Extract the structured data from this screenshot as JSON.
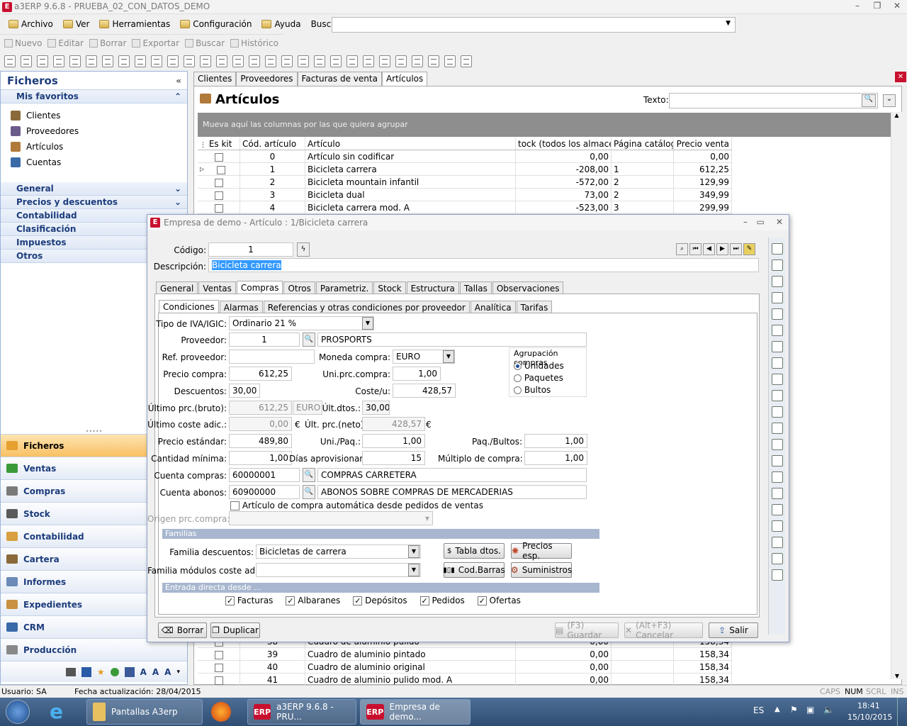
{
  "window": {
    "title": "a3ERP 9.6.8 - PRUEBA_02_CON_DATOS_DEMO",
    "logo": "E"
  },
  "menu": {
    "items": [
      "Archivo",
      "Ver",
      "Herramientas",
      "Configuración",
      "Ayuda"
    ],
    "search_label": "Buscar opción:",
    "search_value": ""
  },
  "toolbar": {
    "nuevo": "Nuevo",
    "editar": "Editar",
    "borrar": "Borrar",
    "exportar": "Exportar",
    "buscar": "Buscar",
    "historico": "Histórico"
  },
  "left": {
    "title": "Ficheros",
    "favorites_title": "Mis favoritos",
    "favorites": [
      "Clientes",
      "Proveedores",
      "Artículos",
      "Cuentas"
    ],
    "sections": [
      "General",
      "Precios y descuentos",
      "Contabilidad",
      "Clasificación",
      "Impuestos",
      "Otros"
    ],
    "nav": [
      "Ficheros",
      "Ventas",
      "Compras",
      "Stock",
      "Contabilidad",
      "Cartera",
      "Informes",
      "Expedientes",
      "CRM",
      "Producción"
    ],
    "bottom_icons": [
      "monitor-icon",
      "iva-free-icon",
      "star-icon",
      "globe-icon",
      "chart-icon",
      "a3-icon",
      "a3-icon",
      "a3-icon"
    ]
  },
  "tabs": [
    "Clientes",
    "Proveedores",
    "Facturas de venta",
    "Artículos"
  ],
  "articles": {
    "title": "Artículos",
    "text_label": "Texto:",
    "group_hint": "Mueva aquí las columnas por las que quiera agrupar",
    "columns": [
      "Es kit",
      "Cód. artículo",
      "Artículo",
      "tock (todos los almacenes)",
      "Página catálogo",
      "Precio venta"
    ],
    "rows": [
      {
        "cod": "0",
        "art": "Artículo sin codificar",
        "stock": "0,00",
        "pag": "",
        "precio": "0,00"
      },
      {
        "cod": "1",
        "art": "Bicicleta carrera",
        "stock": "-208,00",
        "pag": "1",
        "precio": "612,25"
      },
      {
        "cod": "2",
        "art": "Bicicleta mountain infantil",
        "stock": "-572,00",
        "pag": "2",
        "precio": "129,99"
      },
      {
        "cod": "3",
        "art": "Bicicleta dual",
        "stock": "73,00",
        "pag": "2",
        "precio": "349,99"
      },
      {
        "cod": "4",
        "art": "Bicicleta carrera mod. A",
        "stock": "-523,00",
        "pag": "3",
        "precio": "299,99"
      }
    ],
    "rows_bottom": [
      {
        "cod": "38",
        "art": "Cuadro de aluminio pulido",
        "stock": "0,00",
        "pag": "",
        "precio": "158,34"
      },
      {
        "cod": "39",
        "art": "Cuadro de aluminio pintado",
        "stock": "0,00",
        "pag": "",
        "precio": "158,34"
      },
      {
        "cod": "40",
        "art": "Cuadro de aluminio original",
        "stock": "0,00",
        "pag": "",
        "precio": "158,34"
      },
      {
        "cod": "41",
        "art": "Cuadro de aluminio pulido mod. A",
        "stock": "0,00",
        "pag": "",
        "precio": "158,34"
      }
    ]
  },
  "dialog": {
    "title": "Empresa de demo - Artículo : 1/Bicicleta carrera",
    "codigo_label": "Código:",
    "codigo": "1",
    "descripcion_label": "Descripción:",
    "descripcion": "Bicicleta carrera",
    "tabs": [
      "General",
      "Ventas",
      "Compras",
      "Otros",
      "Parametriz.",
      "Stock",
      "Estructura",
      "Tallas",
      "Observaciones"
    ],
    "subtabs": [
      "Condiciones",
      "Alarmas",
      "Referencias y otras condiciones por proveedor",
      "Analítica",
      "Tarifas"
    ],
    "tipo_iva_label": "Tipo de IVA/IGIC:",
    "tipo_iva": "Ordinario 21 %",
    "proveedor_label": "Proveedor:",
    "proveedor": "1",
    "proveedor_nombre": "PROSPORTS",
    "ref_prov_label": "Ref. proveedor:",
    "ref_prov": "",
    "moneda_label": "Moneda compra:",
    "moneda": "EURO",
    "precio_compra_label": "Precio compra:",
    "precio_compra": "612,25",
    "uni_prc_label": "Uni.prc.compra:",
    "uni_prc": "1,00",
    "descuentos_label": "Descuentos:",
    "descuentos": "30,00",
    "coste_label": "Coste/u:",
    "coste": "428,57",
    "ultimo_prc_label": "Último prc.(bruto):",
    "ultimo_prc": "612,25",
    "ultimo_moneda": "EURO",
    "ult_dtos_label": "Últ.dtos.:",
    "ult_dtos": "30,00",
    "ultimo_coste_label": "Último coste adic.:",
    "ultimo_coste": "0,00",
    "euro": "€",
    "ult_neto_label": "Últ. prc.(neto):",
    "ult_neto": "428,57",
    "precio_std_label": "Precio estándar:",
    "precio_std": "489,80",
    "uni_paq_label": "Uni./Paq.:",
    "uni_paq": "1,00",
    "paq_bultos_label": "Paq./Bultos:",
    "paq_bultos": "1,00",
    "cant_min_label": "Cantidad mínima:",
    "cant_min": "1,00",
    "dias_label": "Días aprovisionam.:",
    "dias": "15",
    "multiplo_label": "Múltiplo de compra:",
    "multiplo": "1,00",
    "cta_compras_label": "Cuenta compras:",
    "cta_compras": "60000001",
    "cta_compras_nombre": "COMPRAS CARRETERA",
    "cta_abonos_label": "Cuenta abonos:",
    "cta_abonos": "60900000",
    "cta_abonos_nombre": "ABONOS SOBRE COMPRAS DE MERCADERIAS",
    "auto_label": "Artículo de compra automática desde pedidos de ventas",
    "origen_label": "Origen prc.compra:",
    "agrup_title": "Agrupación compras",
    "agrup_options": [
      "Unidades",
      "Paquetes",
      "Bultos"
    ],
    "familias_band": "Familias",
    "fam_dtos_label": "Familia descuentos:",
    "fam_dtos": "Bicicletas de carrera",
    "fam_mod_label": "Familia módulos coste adic.:",
    "fam_mod": "",
    "btn_tabla": "Tabla dtos.",
    "btn_precios": "Precios esp.",
    "btn_cod": "Cod.Barras",
    "btn_sumin": "Suministros",
    "entrada_band": "Entrada directa desde ...",
    "entrada": [
      "Facturas",
      "Albaranes",
      "Depósitos",
      "Pedidos",
      "Ofertas"
    ],
    "btn_borrar": "Borrar",
    "btn_duplicar": "Duplicar",
    "btn_guardar": "(F3) Guardar",
    "btn_cancelar": "(Alt+F3) Cancelar",
    "btn_salir": "Salir"
  },
  "status": {
    "usuario": "Usuario: SA",
    "fecha": "Fecha actualización: 28/04/2015",
    "caps": "CAPS",
    "num": "NUM",
    "scrl": "SCRL",
    "ins": "INS"
  },
  "taskbar": {
    "pantallas": "Pantallas A3erp",
    "erp1": "a3ERP 9.6.8 - PRU...",
    "erp2": "Empresa de demo...",
    "lang": "ES",
    "time": "18:41",
    "date": "15/10/2015",
    "erp_logo": "ERP"
  }
}
